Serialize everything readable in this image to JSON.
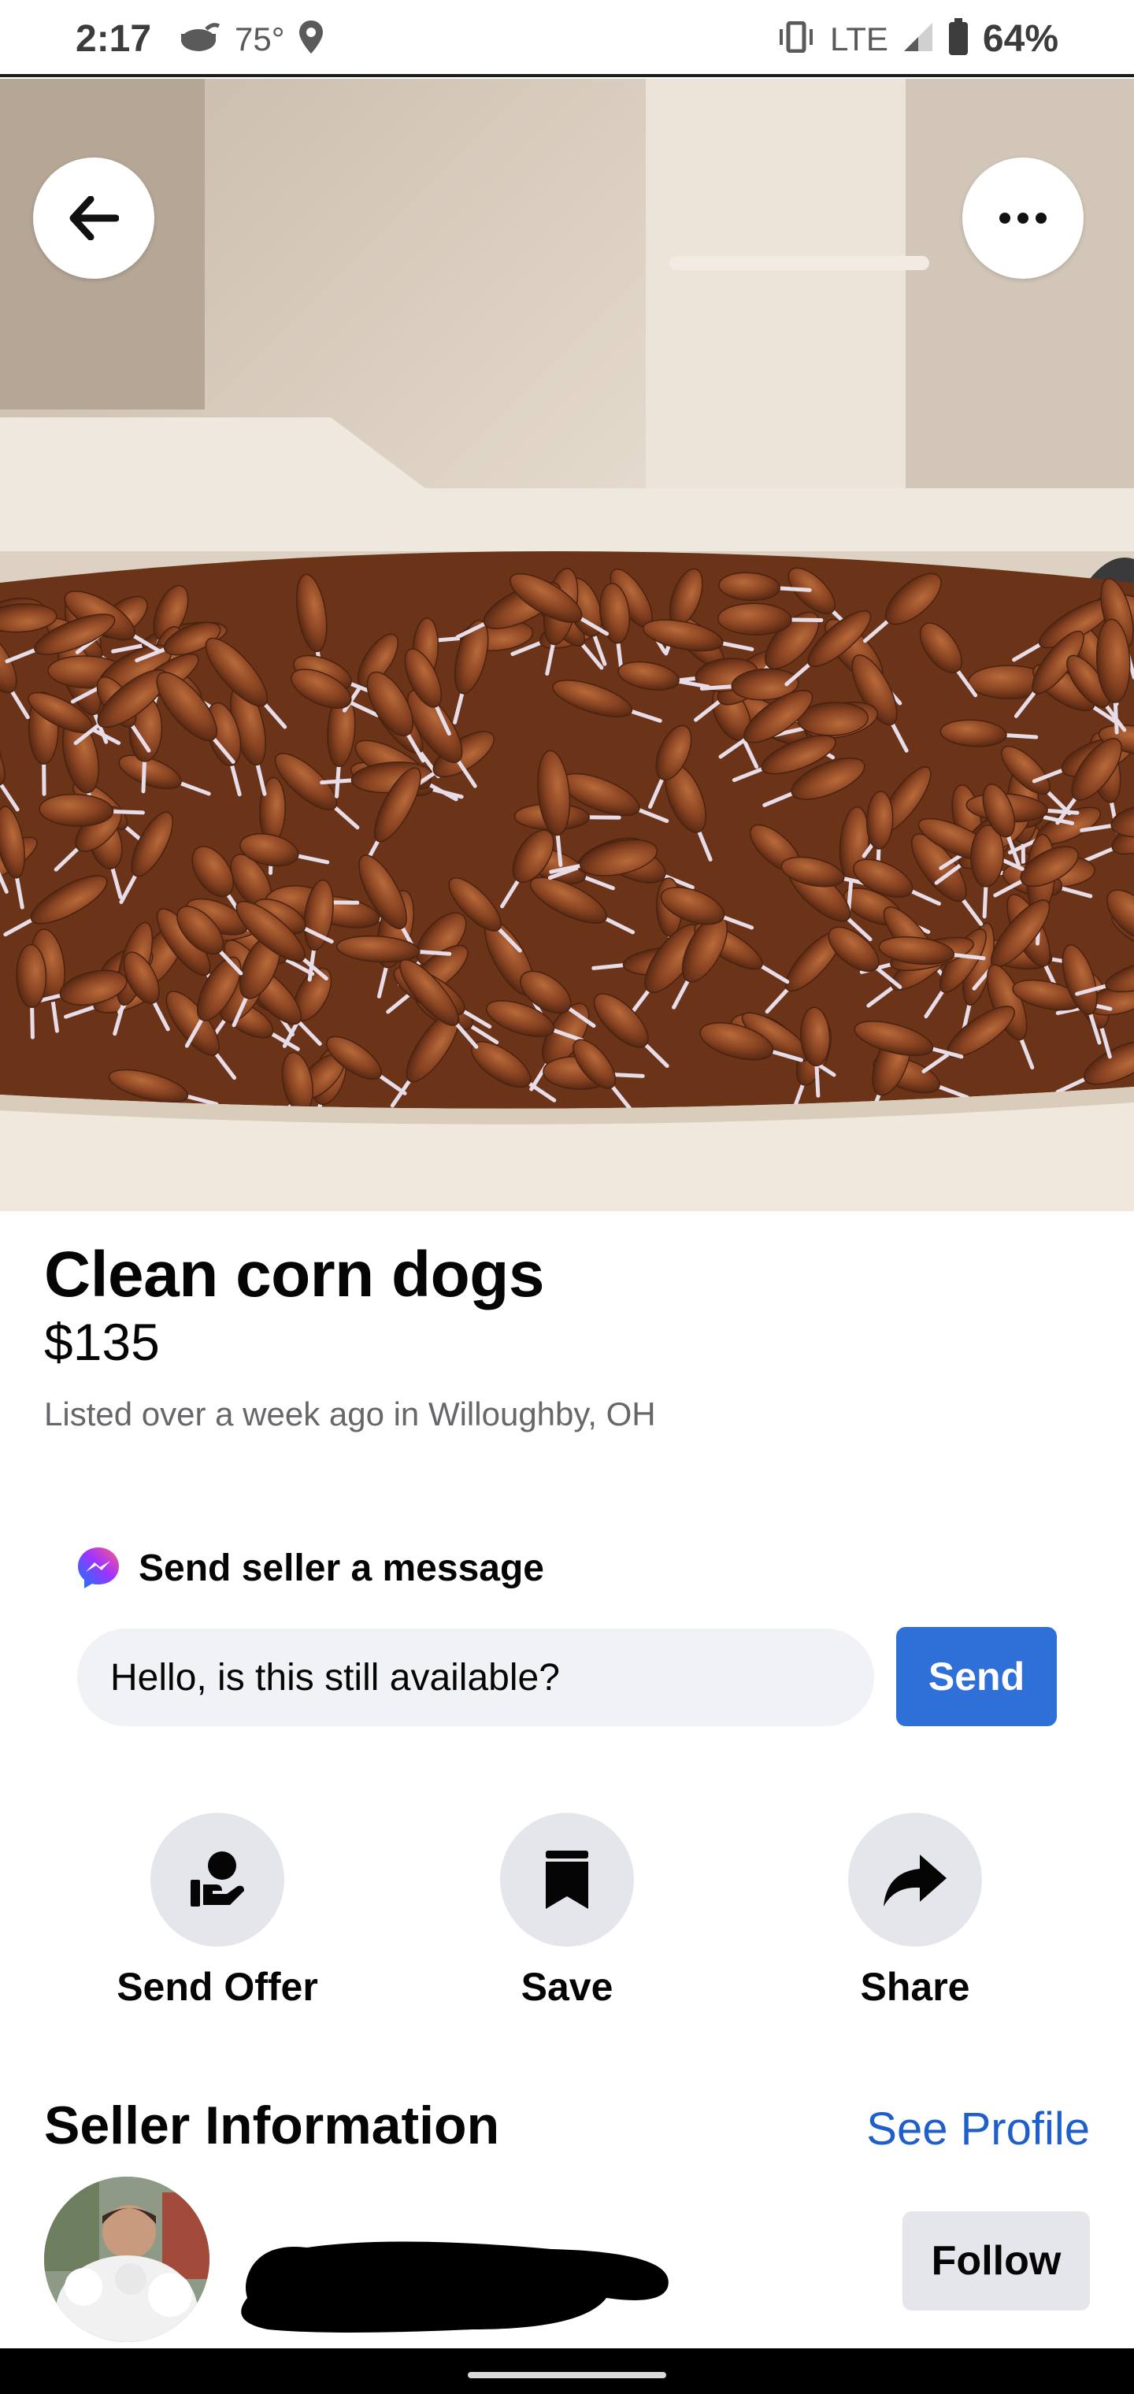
{
  "status_bar": {
    "time": "2:17",
    "temperature": "75°",
    "network": "LTE",
    "battery": "64%",
    "icons": [
      "weather-icon",
      "location-icon",
      "vibrate-icon",
      "signal-icon",
      "battery-icon"
    ]
  },
  "hero": {
    "back_icon": "arrow-left-icon",
    "more_icon": "more-horizontal-icon"
  },
  "listing": {
    "title": "Clean corn dogs",
    "price": "$135",
    "listed": "Listed over a week ago in Willoughby, OH"
  },
  "message": {
    "header": "Send seller a message",
    "icon": "messenger-icon",
    "input_value": "Hello, is this still available?",
    "send_label": "Send"
  },
  "actions": [
    {
      "label": "Send Offer",
      "icon": "send-offer-icon"
    },
    {
      "label": "Save",
      "icon": "bookmark-icon"
    },
    {
      "label": "Share",
      "icon": "share-arrow-icon"
    }
  ],
  "seller": {
    "section_title": "Seller Information",
    "see_profile": "See Profile",
    "follow_label": "Follow"
  },
  "colors": {
    "accent": "#2f6fd8",
    "link": "#1f5fc9",
    "secondary_text": "#65676b",
    "button_gray": "#e4e6eb"
  }
}
